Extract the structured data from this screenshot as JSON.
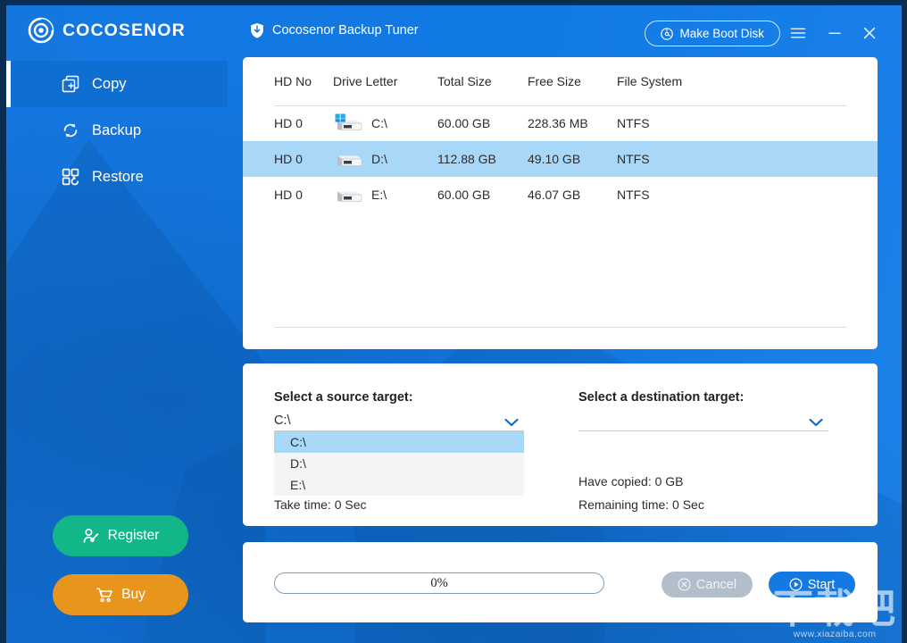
{
  "colors": {
    "accent_blue": "#1278e0",
    "sidebar_active": "#0f6ed2",
    "register_green": "#13b689",
    "buy_orange": "#e8951d",
    "row_selected": "#a9d7f8",
    "start_blue": "#1579e4",
    "cancel_disabled": "#b2bfcb",
    "window_border": "#0a2d52"
  },
  "sidebar": {
    "brand": "COCOSENOR",
    "brand_icon": "cocosenor-logo-icon",
    "items": [
      {
        "label": "Copy",
        "icon": "copy-icon",
        "active": true
      },
      {
        "label": "Backup",
        "icon": "backup-sync-icon",
        "active": false
      },
      {
        "label": "Restore",
        "icon": "restore-grid-icon",
        "active": false
      }
    ],
    "register_label": "Register",
    "register_icon": "user-add-icon",
    "buy_label": "Buy",
    "buy_icon": "shopping-cart-icon"
  },
  "titlebar": {
    "app_icon": "shield-download-icon",
    "title": "Cocosenor Backup Tuner",
    "boot_disk_label": "Make Boot Disk",
    "boot_disk_icon": "disc-icon",
    "menu_icon": "hamburger-menu-icon",
    "minimize_icon": "minimize-icon",
    "close_icon": "close-icon"
  },
  "table": {
    "columns": [
      "HD No",
      "Drive Letter",
      "Total Size",
      "Free Size",
      "File System"
    ],
    "rows": [
      {
        "hd_no": "HD 0",
        "drive_letter": "C:\\",
        "total_size": "60.00 GB",
        "free_size": "228.36 MB",
        "file_system": "NTFS",
        "icon": "hard-drive-windows-icon",
        "selected": false
      },
      {
        "hd_no": "HD 0",
        "drive_letter": "D:\\",
        "total_size": "112.88 GB",
        "free_size": "49.10 GB",
        "file_system": "NTFS",
        "icon": "hard-drive-icon",
        "selected": true
      },
      {
        "hd_no": "HD 0",
        "drive_letter": "E:\\",
        "total_size": "60.00 GB",
        "free_size": "46.07 GB",
        "file_system": "NTFS",
        "icon": "hard-drive-icon",
        "selected": false
      }
    ]
  },
  "targets": {
    "source_label": "Select a source target:",
    "source_value": "C:\\",
    "source_options": [
      "C:\\",
      "D:\\",
      "E:\\"
    ],
    "source_selected_option": "C:\\",
    "source_dropdown_open": true,
    "destination_label": "Select a destination target:",
    "destination_value": "",
    "chevron_icon": "chevron-down-icon",
    "take_time": "Take time:  0 Sec",
    "have_copied": "Have  copied:  0 GB",
    "remaining_time": "Remaining time:  0 Sec"
  },
  "action": {
    "progress_text": "0%",
    "progress_percent": 0,
    "cancel_label": "Cancel",
    "cancel_icon": "cancel-circle-icon",
    "cancel_disabled": true,
    "start_label": "Start",
    "start_icon": "play-circle-icon"
  },
  "watermark": {
    "logo_text": "下载吧",
    "url_text": "www.xiazaiba.com"
  }
}
